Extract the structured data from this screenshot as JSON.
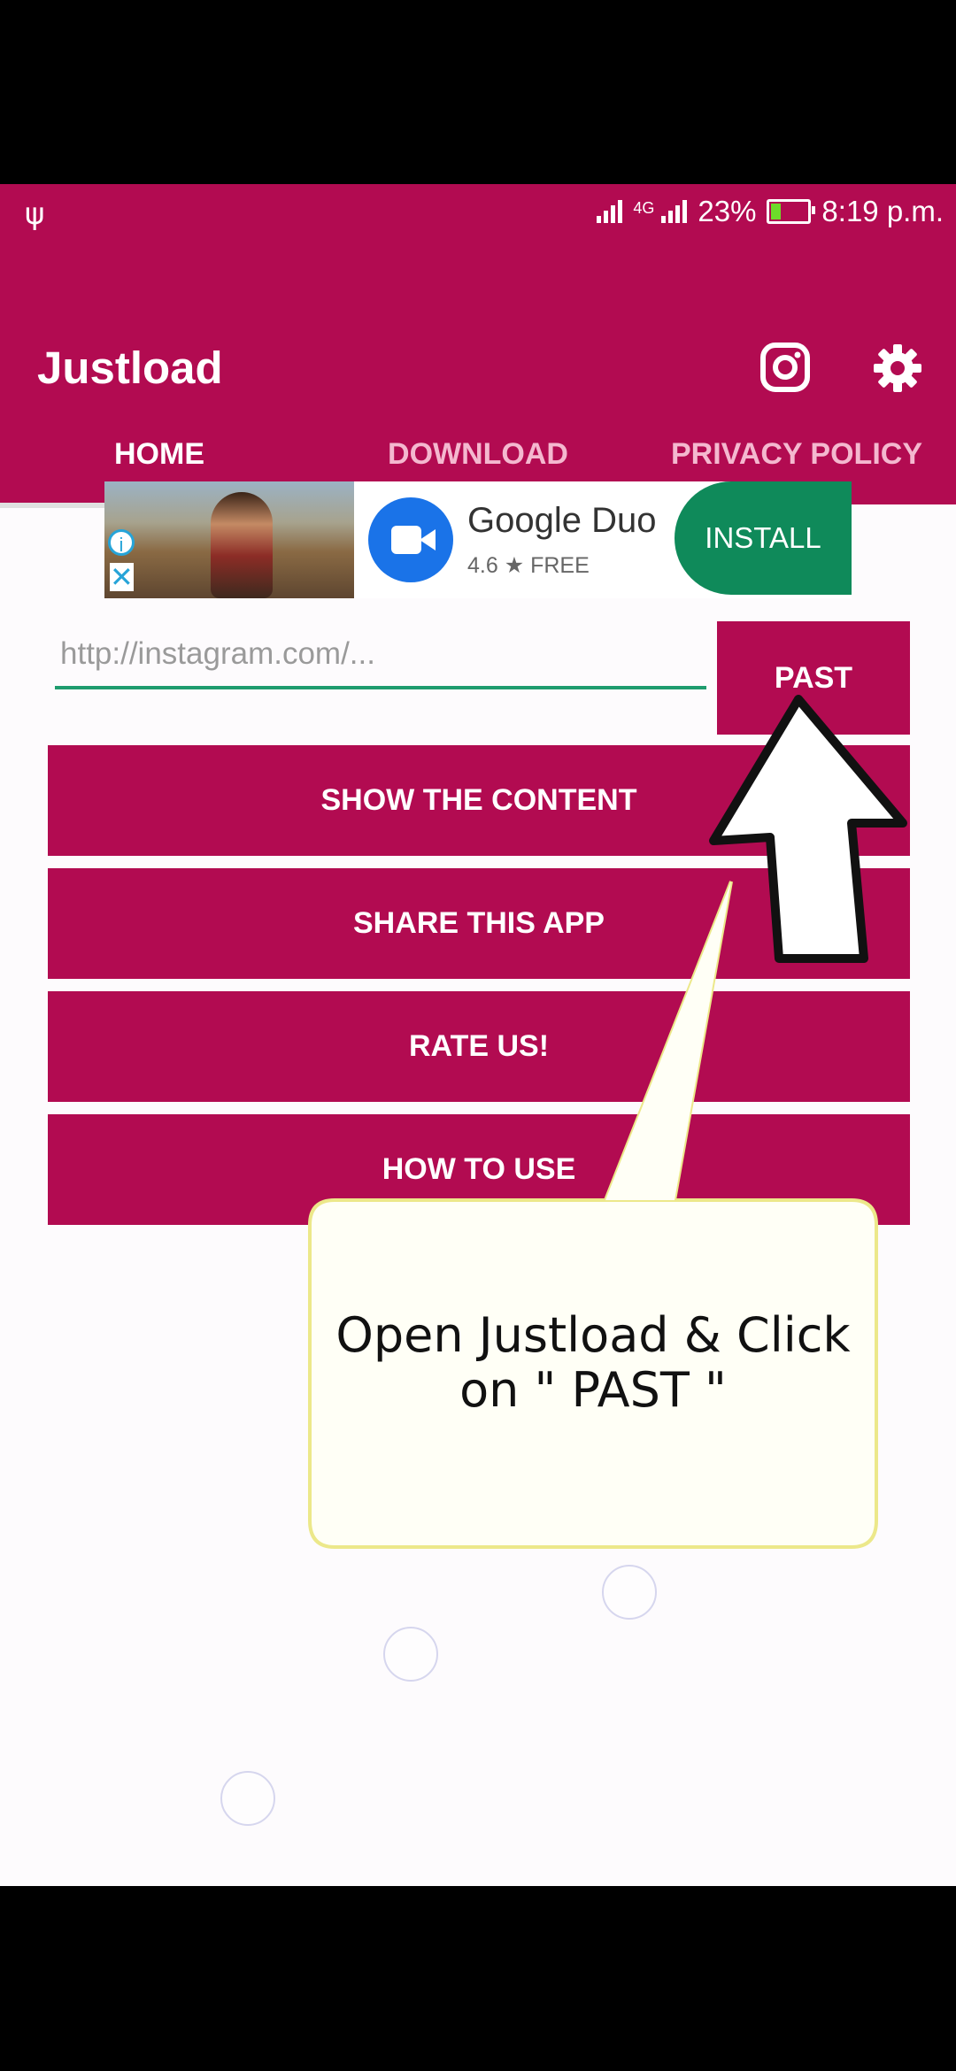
{
  "status_bar": {
    "battery": "23%",
    "battery_level": 0.23,
    "time": "8:19 p.m.",
    "network": "4G",
    "usb_icon": "usb-icon"
  },
  "app": {
    "title": "Justload",
    "icons": [
      "instagram-icon",
      "gear-icon"
    ]
  },
  "tabs": [
    {
      "label": "HOME",
      "active": true
    },
    {
      "label": "DOWNLOAD",
      "active": false
    },
    {
      "label": "PRIVACY POLICY",
      "active": false
    }
  ],
  "ad": {
    "app_name": "Google Duo",
    "rating": "4.6",
    "price": "FREE",
    "install_label": "INSTALL"
  },
  "url_input": {
    "placeholder": "http://instagram.com/...",
    "value": ""
  },
  "paste_button": "PAST",
  "actions": [
    {
      "label": "SHOW THE CONTENT"
    },
    {
      "label": "SHARE THIS APP"
    },
    {
      "label": "RATE US!"
    },
    {
      "label": "HOW TO USE"
    }
  ],
  "callout": {
    "line1": "Open Justload & Click",
    "line2": "on \" PAST \""
  },
  "colors": {
    "primary": "#b20b51",
    "accent": "#1f9c6e",
    "install": "#0f8a5a"
  }
}
